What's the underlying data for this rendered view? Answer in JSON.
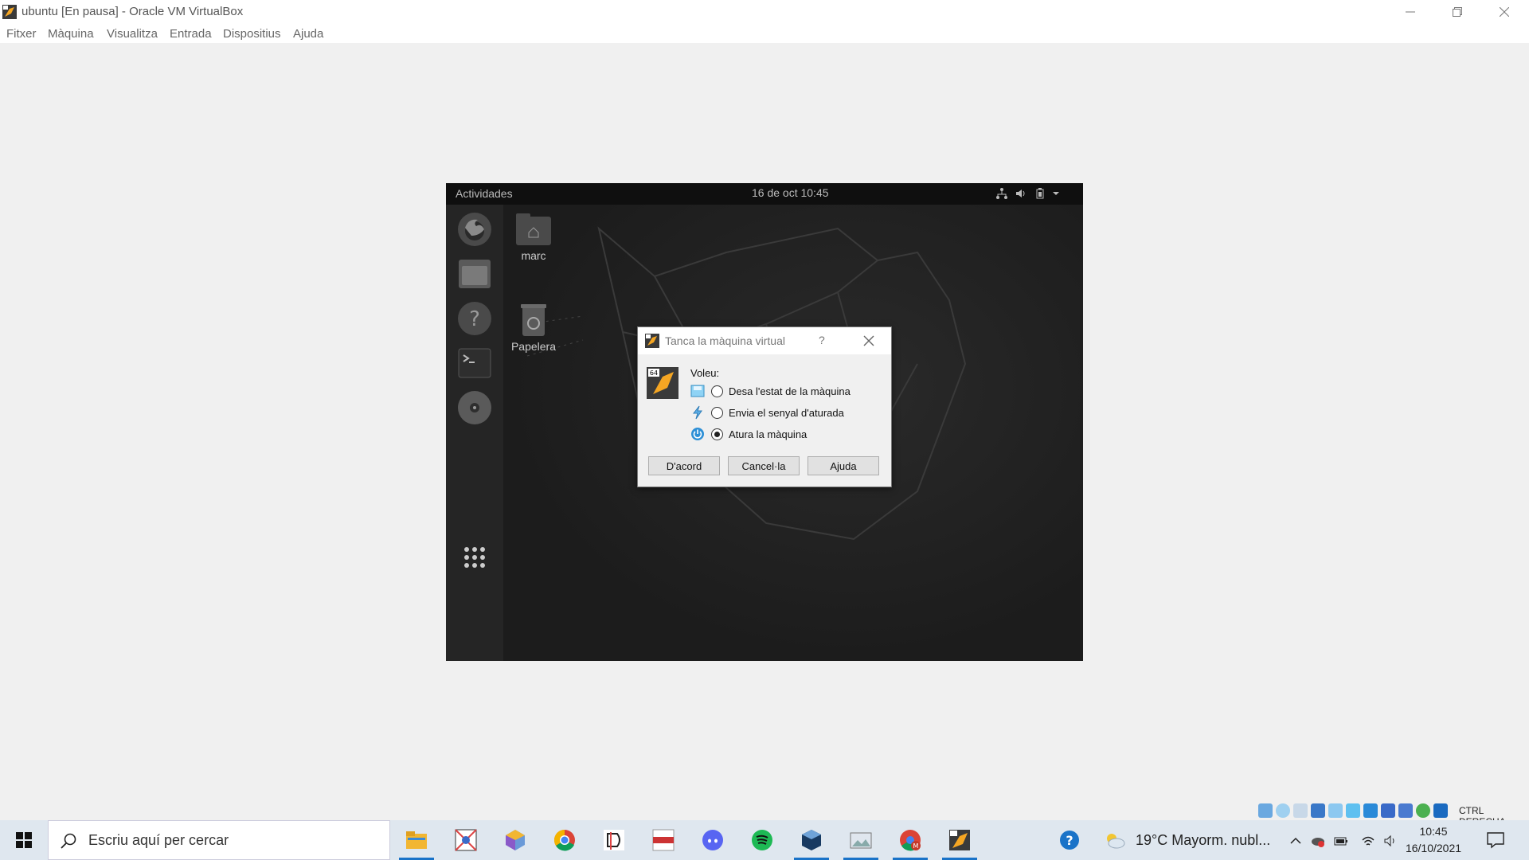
{
  "window": {
    "title": "ubuntu [En pausa] - Oracle VM VirtualBox"
  },
  "menu": {
    "items": [
      "Fitxer",
      "Màquina",
      "Visualitza",
      "Entrada",
      "Dispositius",
      "Ajuda"
    ]
  },
  "guest": {
    "activities_label": "Actividades",
    "clock": "16 de oct  10:45",
    "dock_apps": [
      "firefox-icon",
      "files-icon",
      "help-icon",
      "terminal-icon",
      "disc-icon",
      "app-grid-icon"
    ],
    "desktop_icons": [
      {
        "label": "marc",
        "icon": "home-folder-icon"
      },
      {
        "label": "Papelera",
        "icon": "trash-icon"
      }
    ]
  },
  "dialog": {
    "title": "Tanca la màquina virtual",
    "help_glyph": "?",
    "prompt": "Voleu:",
    "options": [
      {
        "label": "Desa l'estat de la màquina",
        "icon": "save-state-icon",
        "checked": false
      },
      {
        "label": "Envia el senyal d'aturada",
        "icon": "acpi-shutdown-icon",
        "checked": false
      },
      {
        "label": "Atura la màquina",
        "icon": "power-off-icon",
        "checked": true
      }
    ],
    "buttons": {
      "ok": "D'acord",
      "cancel": "Cancel·la",
      "help": "Ajuda"
    }
  },
  "statusbar": {
    "host_key": "CTRL DERECHA"
  },
  "taskbar": {
    "search_placeholder": "Escriu aquí per cercar",
    "weather": "19°C  Mayorm. nubl...",
    "time": "10:45",
    "date": "16/10/2021",
    "apps": [
      "file-explorer-icon",
      "maps-app-icon",
      "cube-app-icon",
      "chrome-icon",
      "dev-app-icon",
      "base-app-icon",
      "discord-icon",
      "spotify-icon",
      "virtualbox-icon",
      "photos-icon",
      "chrome-profile-icon",
      "vm-window-icon"
    ]
  }
}
